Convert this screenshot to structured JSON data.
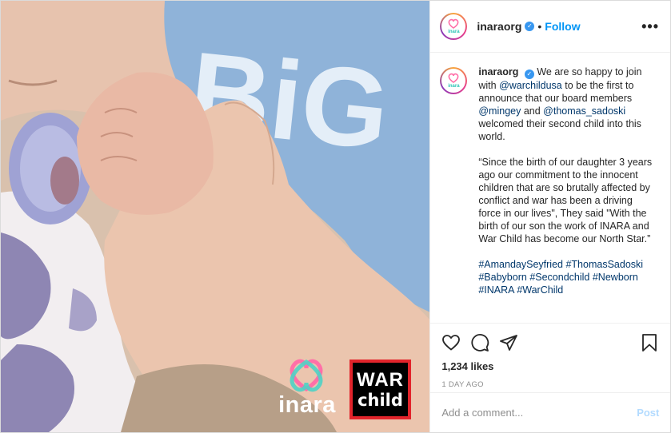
{
  "account": {
    "username": "inaraorg",
    "follow_label": "Follow",
    "separator": "•",
    "more_label": "•••",
    "avatar_text": "inara"
  },
  "caption": {
    "username": "inaraorg",
    "p1_a": "We are so happy to join with ",
    "p1_mention1": "@warchildusa",
    "p1_b": " to be the first to announce that our board members ",
    "p1_mention2": "@mingey",
    "p1_c": " and ",
    "p1_mention3": "@thomas_sadoski",
    "p1_d": " welcomed their second child into this world.",
    "p2": "“Since the birth of our daughter 3 years ago our commitment to the innocent children that are so brutally affected by conflict and war has been a driving force in our lives\", They said \"With the birth of our son the work of INARA and War Child has become our North Star.”",
    "hashtags": [
      "#AmandaySeyfried",
      "#ThomasSadoski",
      "#Babyborn",
      "#Secondchild",
      "#Newborn",
      "#INARA",
      "#WarChild"
    ]
  },
  "stats": {
    "likes": "1,234 likes",
    "time_ago": "1 DAY AGO"
  },
  "comment": {
    "placeholder": "Add a comment...",
    "post_label": "Post"
  },
  "photo": {
    "shirt_text": "BiG",
    "inara_logo": "inara",
    "warchild_line1": "WAR",
    "warchild_line2": "child"
  },
  "icons": {
    "like": "heart-icon",
    "comment": "comment-icon",
    "share": "share-icon",
    "save": "bookmark-icon",
    "verified": "verified-icon",
    "more": "more-options-icon"
  },
  "colors": {
    "accent": "#0095f6",
    "verified": "#3897f0",
    "post_disabled": "#b3dbff",
    "warchild_red": "#e2242b",
    "shirt_blue": "#8fb3d9"
  }
}
